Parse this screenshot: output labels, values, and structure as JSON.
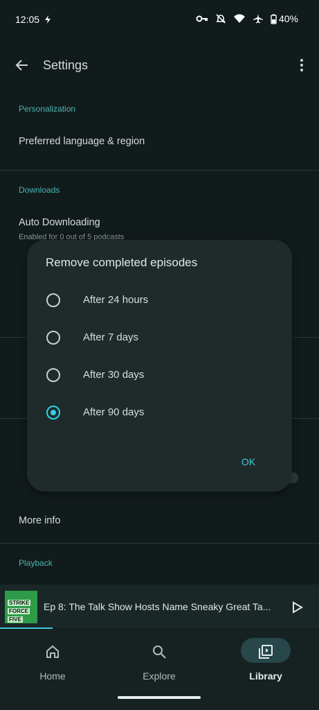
{
  "status": {
    "time": "12:05",
    "battery": "40%"
  },
  "appbar": {
    "title": "Settings"
  },
  "sections": {
    "personalization": "Personalization",
    "downloads": "Downloads",
    "playback": "Playback"
  },
  "rows": {
    "language": "Preferred language & region",
    "auto_download_title": "Auto Downloading",
    "auto_download_sub": "Enabled for 0 out of 5 podcasts",
    "more_info": "More info"
  },
  "dialog": {
    "title": "Remove completed episodes",
    "options": [
      {
        "label": "After 24 hours",
        "selected": false
      },
      {
        "label": "After 7 days",
        "selected": false
      },
      {
        "label": "After 30 days",
        "selected": false
      },
      {
        "label": "After 90 days",
        "selected": true
      }
    ],
    "ok": "OK"
  },
  "player": {
    "episode_title": "Ep 8: The Talk Show Hosts Name Sneaky Great Ta...",
    "art_lines": [
      "STRIKE",
      "FORCE",
      "FIVE"
    ]
  },
  "nav": [
    {
      "label": "Home",
      "icon": "home-icon",
      "active": false
    },
    {
      "label": "Explore",
      "icon": "search-icon",
      "active": false
    },
    {
      "label": "Library",
      "icon": "library-icon",
      "active": true
    }
  ],
  "colors": {
    "accent": "#2ad4e6",
    "section": "#4bb4b4",
    "background": "#121b1b",
    "dialog": "#1f2b2b"
  }
}
